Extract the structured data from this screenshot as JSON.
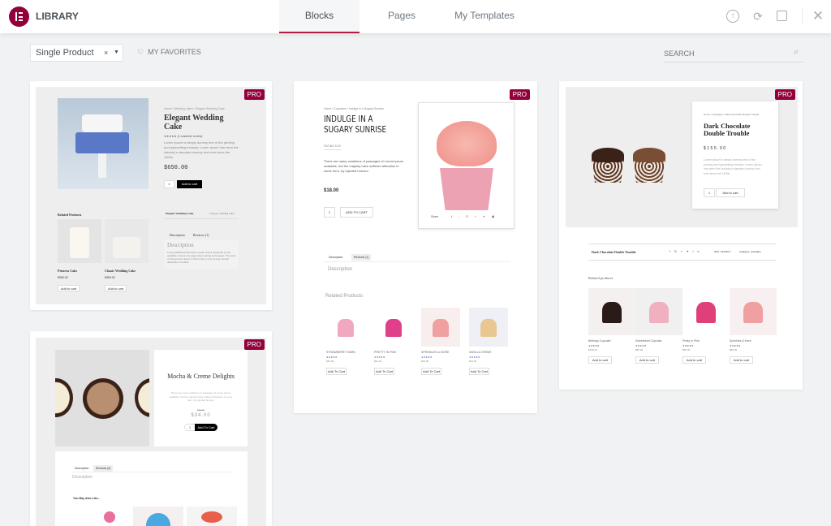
{
  "header": {
    "title": "LIBRARY",
    "tabs": [
      {
        "label": "Blocks",
        "active": true
      },
      {
        "label": "Pages"
      },
      {
        "label": "My Templates"
      }
    ],
    "icons": [
      "upload-icon",
      "sync-icon",
      "save-icon",
      "close-icon"
    ]
  },
  "toolbar": {
    "filter_value": "Single Product",
    "favorites_label": "MY FAVORITES",
    "search_placeholder": "SEARCH"
  },
  "colors": {
    "accent": "#93003c",
    "tab_underline": "#b01b45",
    "background": "#f1f2f3"
  },
  "badge": "PRO",
  "templates": [
    {
      "breadcrumb": "Home / Wedding cakes / Elegant Wedding Cake",
      "title": "Elegant Wedding Cake",
      "reviews": "(1 customer review)",
      "desc": "Lorem Ipsum is simply dummy text of the printing and typesetting industry. Lorem Ipsum has been the industry's standard dummy text ever since the 1500s",
      "price": "$650.00",
      "qty": "1",
      "cart": "Add to cart",
      "meta_title": "Elegant Wedding Cake",
      "meta_cat": "Category: Wedding cakes",
      "tab1": "Description",
      "tab2": "Reviews (1)",
      "desc_heading": "Description",
      "desc_body": "Long established fact that a reader will be distracted by the readable content of a page when looking at its layout. The point of using Lorem Ipsum is that it has a more-or-less normal distribution of letters",
      "related": "Related Products",
      "products": [
        {
          "name": "Princess Cake",
          "price": "$350.00",
          "cart": "Add to cart"
        },
        {
          "name": "Classic Wedding Cake",
          "price": "$350.00",
          "cart": "Add to cart"
        }
      ]
    },
    {
      "breadcrumb": "Home / Cupcakes / Indulge in a Sugary Sunrise",
      "title": "INDULGE IN A SUGARY SUNRISE",
      "rating": "RATING  5.00",
      "desc": "There are many variations of passages of Lorem Ipsum available, but the majority have suffered alteration in some form, by injected humour",
      "price": "$18.00",
      "qty": "1",
      "cart": "ADD TO CART",
      "share": "Share",
      "tab1": "Description",
      "tab2": "Reviews (1)",
      "desc_heading": "Description",
      "related": "Related Products",
      "products": [
        {
          "name": "STRAWBERRY SWIRL",
          "price": "$25.00",
          "cart": "Add To Cart"
        },
        {
          "name": "PRETTY IN PINK",
          "price": "$32.00",
          "cart": "Add To Cart"
        },
        {
          "name": "SPRINKLES & MORE",
          "price": "$25.00",
          "cart": "Add To Cart"
        },
        {
          "name": "VANILLA CREME",
          "price": "$19.00",
          "cart": "Add To Cart"
        }
      ]
    },
    {
      "breadcrumb": "Home / Cupcakes / Dark Chocolate Double Trouble",
      "title": "Dark Chocolate Double Trouble",
      "price": "$155.00",
      "desc": "Lorem Ipsum is simply dummy text of the printing and typesetting industry. Lorem Ipsum has been the industry's standard dummy text ever since the 1500s.",
      "qty": "1",
      "cart": "Add to cart",
      "meta_title": "Dark Chocolate Double Trouble",
      "sku": "SKU: 134790-1",
      "meta_cat": "Category: cupcakes",
      "related": "Related products",
      "products": [
        {
          "name": "Birthday Cupcake",
          "price": "$156.00",
          "cart": "Add to cart"
        },
        {
          "name": "Sweetheart Cupcake",
          "price": "$55.00",
          "cart": "Add to cart"
        },
        {
          "name": "Pretty In Pink",
          "price": "$55.00",
          "cart": "Add to cart"
        },
        {
          "name": "Sprinkles & More",
          "price": "$55.00",
          "cart": "Add to cart"
        }
      ]
    },
    {
      "title": "Mocha & Creme Delights",
      "desc": "There are many variations of passages of Lorem Ipsum available, but the majority have suffered alteration in some form, by injected humour",
      "old_price": "$45.00",
      "price": "$34.00",
      "qty": "1",
      "cart": "Add To Cart",
      "tab1": "Description",
      "tab2": "Reviews (0)",
      "desc_heading": "Description",
      "related": "You May Also Like..."
    }
  ]
}
